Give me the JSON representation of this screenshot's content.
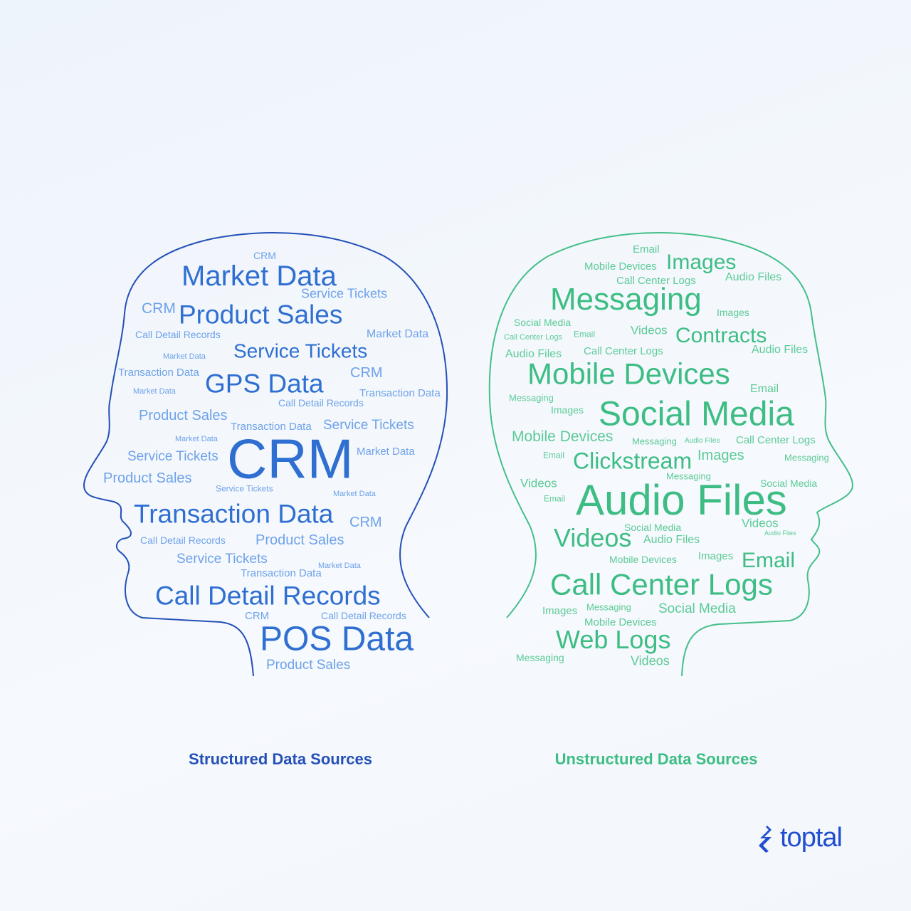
{
  "colors": {
    "structured_dark": "#2f6fd1",
    "structured_light": "#6ea2ea",
    "structured_outline": "#2450b8",
    "unstructured_dark": "#3dbd84",
    "unstructured_light": "#5ccb97",
    "unstructured_outline": "#45bf88",
    "logo": "#204ecf"
  },
  "structured": {
    "caption": "Structured Data Sources",
    "words": [
      "CRM",
      "Market Data",
      "Service Tickets",
      "CRM",
      "Product Sales",
      "Call Detail Records",
      "Market Data",
      "Service Tickets",
      "Market Data",
      "Transaction Data",
      "GPS Data",
      "CRM",
      "Market Data",
      "Transaction Data",
      "Call Detail Records",
      "Product Sales",
      "Transaction Data",
      "Service Tickets",
      "Market Data",
      "Service Tickets",
      "CRM",
      "Market Data",
      "Product Sales",
      "Service Tickets",
      "Market Data",
      "Transaction Data",
      "CRM",
      "Call Detail Records",
      "Product Sales",
      "Service Tickets",
      "Transaction Data",
      "Market Data",
      "Call Detail Records",
      "CRM",
      "Call Detail Records",
      "POS Data",
      "Product Sales"
    ]
  },
  "unstructured": {
    "caption": "Unstructured Data Sources",
    "words": [
      "Email",
      "Mobile Devices",
      "Images",
      "Call Center Logs",
      "Audio Files",
      "Messaging",
      "Images",
      "Social Media",
      "Call Center Logs",
      "Email",
      "Videos",
      "Contracts",
      "Audio Files",
      "Call Center Logs",
      "Audio Files",
      "Mobile Devices",
      "Email",
      "Messaging",
      "Images",
      "Social Media",
      "Mobile Devices",
      "Messaging",
      "Audio Files",
      "Call Center Logs",
      "Email",
      "Clickstream",
      "Images",
      "Messaging",
      "Videos",
      "Messaging",
      "Social Media",
      "Email",
      "Audio Files",
      "Social Media",
      "Videos",
      "Audio Files",
      "Videos",
      "Audio Files",
      "Mobile Devices",
      "Images",
      "Email",
      "Call Center Logs",
      "Images",
      "Messaging",
      "Social Media",
      "Mobile Devices",
      "Web Logs",
      "Messaging",
      "Videos"
    ]
  },
  "logo": {
    "text": "toptal",
    "icon": "toptal-logo-icon"
  }
}
